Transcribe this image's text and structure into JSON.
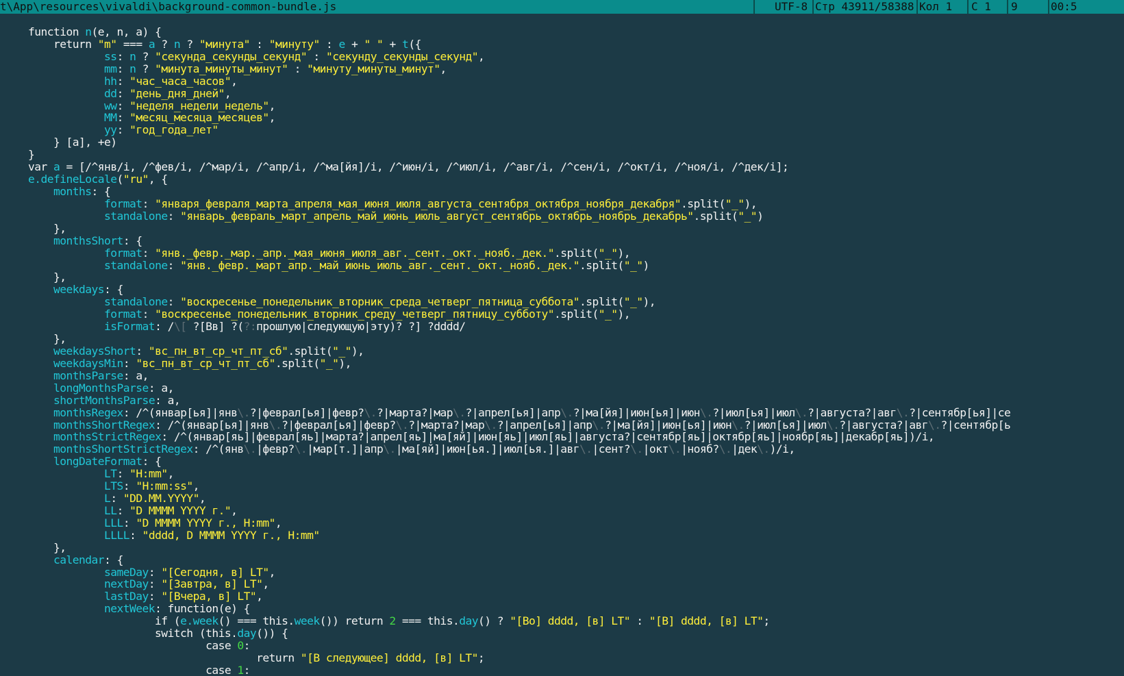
{
  "status_bar": {
    "file_path": "t\\App\\resources\\vivaldi\\background-common-bundle.js",
    "encoding": "UTF-8",
    "line_info": "Стр 43911/58388",
    "column_info": "Кол 1",
    "char_info": "С 1",
    "extra": "9",
    "clock": "00:5"
  },
  "colors": {
    "background": "#1c3a46",
    "status_bar": "#0a8c8c",
    "text": "#f2f2f2",
    "identifier": "#21c6d6",
    "string": "#ffef3a",
    "number": "#45d845"
  },
  "code_lines": [
    [
      [
        "k",
        "    function "
      ],
      [
        "i",
        "n"
      ],
      [
        "k",
        "(e, n, a) {"
      ]
    ],
    [
      [
        "k",
        "        return "
      ],
      [
        "s",
        "\"m\""
      ],
      [
        "k",
        " === "
      ],
      [
        "i",
        "a"
      ],
      [
        "k",
        " ? "
      ],
      [
        "i",
        "n"
      ],
      [
        "k",
        " ? "
      ],
      [
        "s",
        "\"минута\""
      ],
      [
        "k",
        " : "
      ],
      [
        "s",
        "\"минуту\""
      ],
      [
        "k",
        " : "
      ],
      [
        "i",
        "e"
      ],
      [
        "k",
        " + "
      ],
      [
        "s",
        "\" \""
      ],
      [
        "k",
        " + "
      ],
      [
        "i",
        "t"
      ],
      [
        "k",
        "({"
      ]
    ],
    [
      [
        "k",
        "                "
      ],
      [
        "i",
        "ss"
      ],
      [
        "k",
        ": "
      ],
      [
        "i",
        "n"
      ],
      [
        "k",
        " ? "
      ],
      [
        "s",
        "\"секунда_секунды_секунд\""
      ],
      [
        "k",
        " : "
      ],
      [
        "s",
        "\"секунду_секунды_секунд\""
      ],
      [
        "k",
        ","
      ]
    ],
    [
      [
        "k",
        "                "
      ],
      [
        "i",
        "mm"
      ],
      [
        "k",
        ": "
      ],
      [
        "i",
        "n"
      ],
      [
        "k",
        " ? "
      ],
      [
        "s",
        "\"минута_минуты_минут\""
      ],
      [
        "k",
        " : "
      ],
      [
        "s",
        "\"минуту_минуты_минут\""
      ],
      [
        "k",
        ","
      ]
    ],
    [
      [
        "k",
        "                "
      ],
      [
        "i",
        "hh"
      ],
      [
        "k",
        ": "
      ],
      [
        "s",
        "\"час_часа_часов\""
      ],
      [
        "k",
        ","
      ]
    ],
    [
      [
        "k",
        "                "
      ],
      [
        "i",
        "dd"
      ],
      [
        "k",
        ": "
      ],
      [
        "s",
        "\"день_дня_дней\""
      ],
      [
        "k",
        ","
      ]
    ],
    [
      [
        "k",
        "                "
      ],
      [
        "i",
        "ww"
      ],
      [
        "k",
        ": "
      ],
      [
        "s",
        "\"неделя_недели_недель\""
      ],
      [
        "k",
        ","
      ]
    ],
    [
      [
        "k",
        "                "
      ],
      [
        "i",
        "MM"
      ],
      [
        "k",
        ": "
      ],
      [
        "s",
        "\"месяц_месяца_месяцев\""
      ],
      [
        "k",
        ","
      ]
    ],
    [
      [
        "k",
        "                "
      ],
      [
        "i",
        "yy"
      ],
      [
        "k",
        ": "
      ],
      [
        "s",
        "\"год_года_лет\""
      ]
    ],
    [
      [
        "k",
        "        } [a], +e)"
      ]
    ],
    [
      [
        "k",
        "    }"
      ]
    ],
    [
      [
        "k",
        "    var "
      ],
      [
        "i",
        "a"
      ],
      [
        "k",
        " = [/^янв/i, /^фев/i, /^мар/i, /^апр/i, /^ма[йя]/i, /^июн/i, /^июл/i, /^авг/i, /^сен/i, /^окт/i, /^ноя/i, /^дек/i];"
      ]
    ],
    [
      [
        "k",
        "    "
      ],
      [
        "i",
        "e.defineLocale"
      ],
      [
        "k",
        "("
      ],
      [
        "s",
        "\"ru\""
      ],
      [
        "k",
        ", {"
      ]
    ],
    [
      [
        "k",
        "        "
      ],
      [
        "i",
        "months"
      ],
      [
        "k",
        ": {"
      ]
    ],
    [
      [
        "k",
        "                "
      ],
      [
        "i",
        "format"
      ],
      [
        "k",
        ": "
      ],
      [
        "s",
        "\"января_февраля_марта_апреля_мая_июня_июля_августа_сентября_октября_ноября_декабря\""
      ],
      [
        "k",
        ".split("
      ],
      [
        "s",
        "\"_\""
      ],
      [
        "k",
        "),"
      ]
    ],
    [
      [
        "k",
        "                "
      ],
      [
        "i",
        "standalone"
      ],
      [
        "k",
        ": "
      ],
      [
        "s",
        "\"январь_февраль_март_апрель_май_июнь_июль_август_сентябрь_октябрь_ноябрь_декабрь\""
      ],
      [
        "k",
        ".split("
      ],
      [
        "s",
        "\"_\""
      ],
      [
        "k",
        ")"
      ]
    ],
    [
      [
        "k",
        "        },"
      ]
    ],
    [
      [
        "k",
        "        "
      ],
      [
        "i",
        "monthsShort"
      ],
      [
        "k",
        ": {"
      ]
    ],
    [
      [
        "k",
        "                "
      ],
      [
        "i",
        "format"
      ],
      [
        "k",
        ": "
      ],
      [
        "s",
        "\"янв._февр._мар._апр._мая_июня_июля_авг._сент._окт._нояб._дек.\""
      ],
      [
        "k",
        ".split("
      ],
      [
        "s",
        "\"_\""
      ],
      [
        "k",
        "),"
      ]
    ],
    [
      [
        "k",
        "                "
      ],
      [
        "i",
        "standalone"
      ],
      [
        "k",
        ": "
      ],
      [
        "s",
        "\"янв._февр._март_апр._май_июнь_июль_авг._сент._окт._нояб._дек.\""
      ],
      [
        "k",
        ".split("
      ],
      [
        "s",
        "\"_\""
      ],
      [
        "k",
        ")"
      ]
    ],
    [
      [
        "k",
        "        },"
      ]
    ],
    [
      [
        "k",
        "        "
      ],
      [
        "i",
        "weekdays"
      ],
      [
        "k",
        ": {"
      ]
    ],
    [
      [
        "k",
        "                "
      ],
      [
        "i",
        "standalone"
      ],
      [
        "k",
        ": "
      ],
      [
        "s",
        "\"воскресенье_понедельник_вторник_среда_четверг_пятница_суббота\""
      ],
      [
        "k",
        ".split("
      ],
      [
        "s",
        "\"_\""
      ],
      [
        "k",
        "),"
      ]
    ],
    [
      [
        "k",
        "                "
      ],
      [
        "i",
        "format"
      ],
      [
        "k",
        ": "
      ],
      [
        "s",
        "\"воскресенье_понедельник_вторник_среду_четверг_пятницу_субботу\""
      ],
      [
        "k",
        ".split("
      ],
      [
        "s",
        "\"_\""
      ],
      [
        "k",
        "),"
      ]
    ],
    [
      [
        "k",
        "                "
      ],
      [
        "i",
        "isFormat"
      ],
      [
        "k",
        ": /"
      ],
      [
        "g",
        "\\["
      ],
      [
        "k",
        " ?[Вв] ?("
      ],
      [
        "g",
        "?:"
      ],
      [
        "k",
        "прошлую|следующую|эту)? ?] ?dddd/"
      ]
    ],
    [
      [
        "k",
        "        },"
      ]
    ],
    [
      [
        "k",
        "        "
      ],
      [
        "i",
        "weekdaysShort"
      ],
      [
        "k",
        ": "
      ],
      [
        "s",
        "\"вс_пн_вт_ср_чт_пт_сб\""
      ],
      [
        "k",
        ".split("
      ],
      [
        "s",
        "\"_\""
      ],
      [
        "k",
        "),"
      ]
    ],
    [
      [
        "k",
        "        "
      ],
      [
        "i",
        "weekdaysMin"
      ],
      [
        "k",
        ": "
      ],
      [
        "s",
        "\"вс_пн_вт_ср_чт_пт_сб\""
      ],
      [
        "k",
        ".split("
      ],
      [
        "s",
        "\"_\""
      ],
      [
        "k",
        "),"
      ]
    ],
    [
      [
        "k",
        "        "
      ],
      [
        "i",
        "monthsParse"
      ],
      [
        "k",
        ": a,"
      ]
    ],
    [
      [
        "k",
        "        "
      ],
      [
        "i",
        "longMonthsParse"
      ],
      [
        "k",
        ": a,"
      ]
    ],
    [
      [
        "k",
        "        "
      ],
      [
        "i",
        "shortMonthsParse"
      ],
      [
        "k",
        ": a,"
      ]
    ],
    [
      [
        "k",
        "        "
      ],
      [
        "i",
        "monthsRegex"
      ],
      [
        "k",
        ": /^(январ[ья]|янв"
      ],
      [
        "g",
        "\\."
      ],
      [
        "k",
        "?|феврал[ья]|февр?"
      ],
      [
        "g",
        "\\."
      ],
      [
        "k",
        "?|марта?|мар"
      ],
      [
        "g",
        "\\."
      ],
      [
        "k",
        "?|апрел[ья]|апр"
      ],
      [
        "g",
        "\\."
      ],
      [
        "k",
        "?|ма[йя]|июн[ья]|июн"
      ],
      [
        "g",
        "\\."
      ],
      [
        "k",
        "?|июл[ья]|июл"
      ],
      [
        "g",
        "\\."
      ],
      [
        "k",
        "?|августа?|авг"
      ],
      [
        "g",
        "\\."
      ],
      [
        "k",
        "?|сентябр[ья]|се"
      ]
    ],
    [
      [
        "k",
        "        "
      ],
      [
        "i",
        "monthsShortRegex"
      ],
      [
        "k",
        ": /^(январ[ья]|янв"
      ],
      [
        "g",
        "\\."
      ],
      [
        "k",
        "?|феврал[ья]|февр?"
      ],
      [
        "g",
        "\\."
      ],
      [
        "k",
        "?|марта?|мар"
      ],
      [
        "g",
        "\\."
      ],
      [
        "k",
        "?|апрел[ья]|апр"
      ],
      [
        "g",
        "\\."
      ],
      [
        "k",
        "?|ма[йя]|июн[ья]|июн"
      ],
      [
        "g",
        "\\."
      ],
      [
        "k",
        "?|июл[ья]|июл"
      ],
      [
        "g",
        "\\."
      ],
      [
        "k",
        "?|августа?|авг"
      ],
      [
        "g",
        "\\."
      ],
      [
        "k",
        "?|сентябр[ь"
      ]
    ],
    [
      [
        "k",
        "        "
      ],
      [
        "i",
        "monthsStrictRegex"
      ],
      [
        "k",
        ": /^(январ[яь]|феврал[яь]|марта?|апрел[яь]|ма[яй]|июн[яь]|июл[яь]|августа?|сентябр[яь]|октябр[яь]|ноябр[яь]|декабр[яь])/i,"
      ]
    ],
    [
      [
        "k",
        "        "
      ],
      [
        "i",
        "monthsShortStrictRegex"
      ],
      [
        "k",
        ": /^(янв"
      ],
      [
        "g",
        "\\."
      ],
      [
        "k",
        "|февр?"
      ],
      [
        "g",
        "\\."
      ],
      [
        "k",
        "|мар[т.]|апр"
      ],
      [
        "g",
        "\\."
      ],
      [
        "k",
        "|ма[яй]|июн[ья.]|июл[ья.]|авг"
      ],
      [
        "g",
        "\\."
      ],
      [
        "k",
        "|сент?"
      ],
      [
        "g",
        "\\."
      ],
      [
        "k",
        "|окт"
      ],
      [
        "g",
        "\\."
      ],
      [
        "k",
        "|нояб?"
      ],
      [
        "g",
        "\\."
      ],
      [
        "k",
        "|дек"
      ],
      [
        "g",
        "\\."
      ],
      [
        "k",
        ")/i,"
      ]
    ],
    [
      [
        "k",
        "        "
      ],
      [
        "i",
        "longDateFormat"
      ],
      [
        "k",
        ": {"
      ]
    ],
    [
      [
        "k",
        "                "
      ],
      [
        "i",
        "LT"
      ],
      [
        "k",
        ": "
      ],
      [
        "s",
        "\"H:mm\""
      ],
      [
        "k",
        ","
      ]
    ],
    [
      [
        "k",
        "                "
      ],
      [
        "i",
        "LTS"
      ],
      [
        "k",
        ": "
      ],
      [
        "s",
        "\"H:mm:ss\""
      ],
      [
        "k",
        ","
      ]
    ],
    [
      [
        "k",
        "                "
      ],
      [
        "i",
        "L"
      ],
      [
        "k",
        ": "
      ],
      [
        "s",
        "\"DD.MM.YYYY\""
      ],
      [
        "k",
        ","
      ]
    ],
    [
      [
        "k",
        "                "
      ],
      [
        "i",
        "LL"
      ],
      [
        "k",
        ": "
      ],
      [
        "s",
        "\"D MMMM YYYY г.\""
      ],
      [
        "k",
        ","
      ]
    ],
    [
      [
        "k",
        "                "
      ],
      [
        "i",
        "LLL"
      ],
      [
        "k",
        ": "
      ],
      [
        "s",
        "\"D MMMM YYYY г., H:mm\""
      ],
      [
        "k",
        ","
      ]
    ],
    [
      [
        "k",
        "                "
      ],
      [
        "i",
        "LLLL"
      ],
      [
        "k",
        ": "
      ],
      [
        "s",
        "\"dddd, D MMMM YYYY г., H:mm\""
      ]
    ],
    [
      [
        "k",
        "        },"
      ]
    ],
    [
      [
        "k",
        "        "
      ],
      [
        "i",
        "calendar"
      ],
      [
        "k",
        ": {"
      ]
    ],
    [
      [
        "k",
        "                "
      ],
      [
        "i",
        "sameDay"
      ],
      [
        "k",
        ": "
      ],
      [
        "s",
        "\"[Сегодня, в] LT\""
      ],
      [
        "k",
        ","
      ]
    ],
    [
      [
        "k",
        "                "
      ],
      [
        "i",
        "nextDay"
      ],
      [
        "k",
        ": "
      ],
      [
        "s",
        "\"[Завтра, в] LT\""
      ],
      [
        "k",
        ","
      ]
    ],
    [
      [
        "k",
        "                "
      ],
      [
        "i",
        "lastDay"
      ],
      [
        "k",
        ": "
      ],
      [
        "s",
        "\"[Вчера, в] LT\""
      ],
      [
        "k",
        ","
      ]
    ],
    [
      [
        "k",
        "                "
      ],
      [
        "i",
        "nextWeek"
      ],
      [
        "k",
        ": function(e) {"
      ]
    ],
    [
      [
        "k",
        "                        if ("
      ],
      [
        "i",
        "e.week"
      ],
      [
        "k",
        "() === this."
      ],
      [
        "i",
        "week"
      ],
      [
        "k",
        "()) return "
      ],
      [
        "n",
        "2"
      ],
      [
        "k",
        " === this."
      ],
      [
        "i",
        "day"
      ],
      [
        "k",
        "() ? "
      ],
      [
        "s",
        "\"[Во] dddd, [в] LT\""
      ],
      [
        "k",
        " : "
      ],
      [
        "s",
        "\"[В] dddd, [в] LT\""
      ],
      [
        "k",
        ";"
      ]
    ],
    [
      [
        "k",
        "                        switch (this."
      ],
      [
        "i",
        "day"
      ],
      [
        "k",
        "()) {"
      ]
    ],
    [
      [
        "k",
        "                                case "
      ],
      [
        "n",
        "0"
      ],
      [
        "k",
        ":"
      ]
    ],
    [
      [
        "k",
        "                                        return "
      ],
      [
        "s",
        "\"[В следующее] dddd, [в] LT\""
      ],
      [
        "k",
        ";"
      ]
    ],
    [
      [
        "k",
        "                                case "
      ],
      [
        "n",
        "1"
      ],
      [
        "k",
        ":"
      ]
    ]
  ]
}
